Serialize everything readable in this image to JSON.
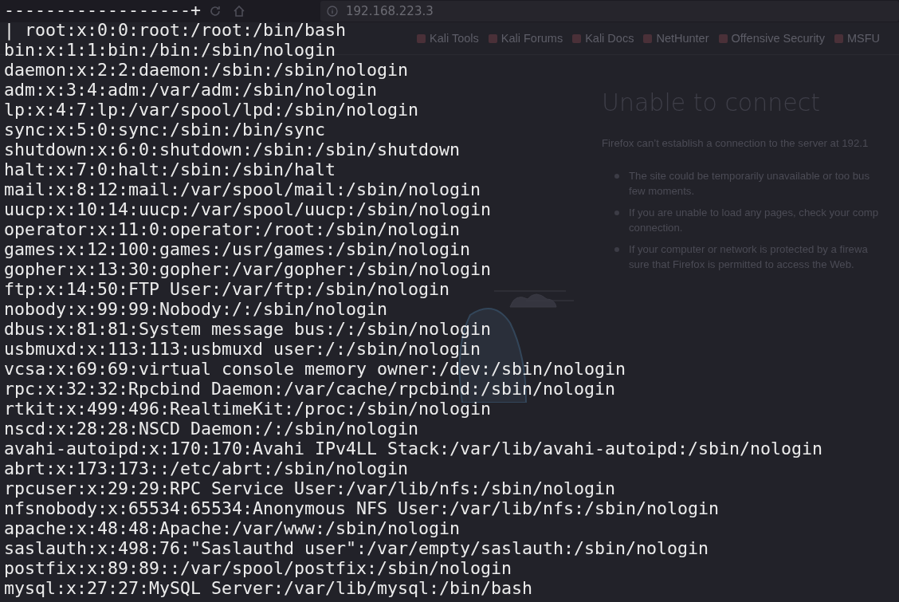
{
  "browser": {
    "url": "192.168.223.3",
    "bookmarks": [
      "Kali Tools",
      "Kali Forums",
      "Kali Docs",
      "NetHunter",
      "Offensive Security",
      "MSFU"
    ],
    "error_page": {
      "title": "Unable to connect",
      "message": "Firefox can’t establish a connection to the server at 192.1",
      "bullets": [
        "The site could be temporarily unavailable or too bus\nfew moments.",
        "If you are unable to load any pages, check your comp\nconnection.",
        "If your computer or network is protected by a firewa\nsure that Firefox is permitted to access the Web."
      ]
    }
  },
  "terminal": {
    "lines": [
      "------------------+",
      "| root:x:0:0:root:/root:/bin/bash",
      "bin:x:1:1:bin:/bin:/sbin/nologin",
      "daemon:x:2:2:daemon:/sbin:/sbin/nologin",
      "adm:x:3:4:adm:/var/adm:/sbin/nologin",
      "lp:x:4:7:lp:/var/spool/lpd:/sbin/nologin",
      "sync:x:5:0:sync:/sbin:/bin/sync",
      "shutdown:x:6:0:shutdown:/sbin:/sbin/shutdown",
      "halt:x:7:0:halt:/sbin:/sbin/halt",
      "mail:x:8:12:mail:/var/spool/mail:/sbin/nologin",
      "uucp:x:10:14:uucp:/var/spool/uucp:/sbin/nologin",
      "operator:x:11:0:operator:/root:/sbin/nologin",
      "games:x:12:100:games:/usr/games:/sbin/nologin",
      "gopher:x:13:30:gopher:/var/gopher:/sbin/nologin",
      "ftp:x:14:50:FTP User:/var/ftp:/sbin/nologin",
      "nobody:x:99:99:Nobody:/:/sbin/nologin",
      "dbus:x:81:81:System message bus:/:/sbin/nologin",
      "usbmuxd:x:113:113:usbmuxd user:/:/sbin/nologin",
      "vcsa:x:69:69:virtual console memory owner:/dev:/sbin/nologin",
      "rpc:x:32:32:Rpcbind Daemon:/var/cache/rpcbind:/sbin/nologin",
      "rtkit:x:499:496:RealtimeKit:/proc:/sbin/nologin",
      "nscd:x:28:28:NSCD Daemon:/:/sbin/nologin",
      "avahi-autoipd:x:170:170:Avahi IPv4LL Stack:/var/lib/avahi-autoipd:/sbin/nologin",
      "abrt:x:173:173::/etc/abrt:/sbin/nologin",
      "rpcuser:x:29:29:RPC Service User:/var/lib/nfs:/sbin/nologin",
      "nfsnobody:x:65534:65534:Anonymous NFS User:/var/lib/nfs:/sbin/nologin",
      "apache:x:48:48:Apache:/var/www:/sbin/nologin",
      "saslauth:x:498:76:\"Saslauthd user\":/var/empty/saslauth:/sbin/nologin",
      "postfix:x:89:89::/var/spool/postfix:/sbin/nologin",
      "mysql:x:27:27:MySQL Server:/var/lib/mysql:/bin/bash"
    ]
  }
}
